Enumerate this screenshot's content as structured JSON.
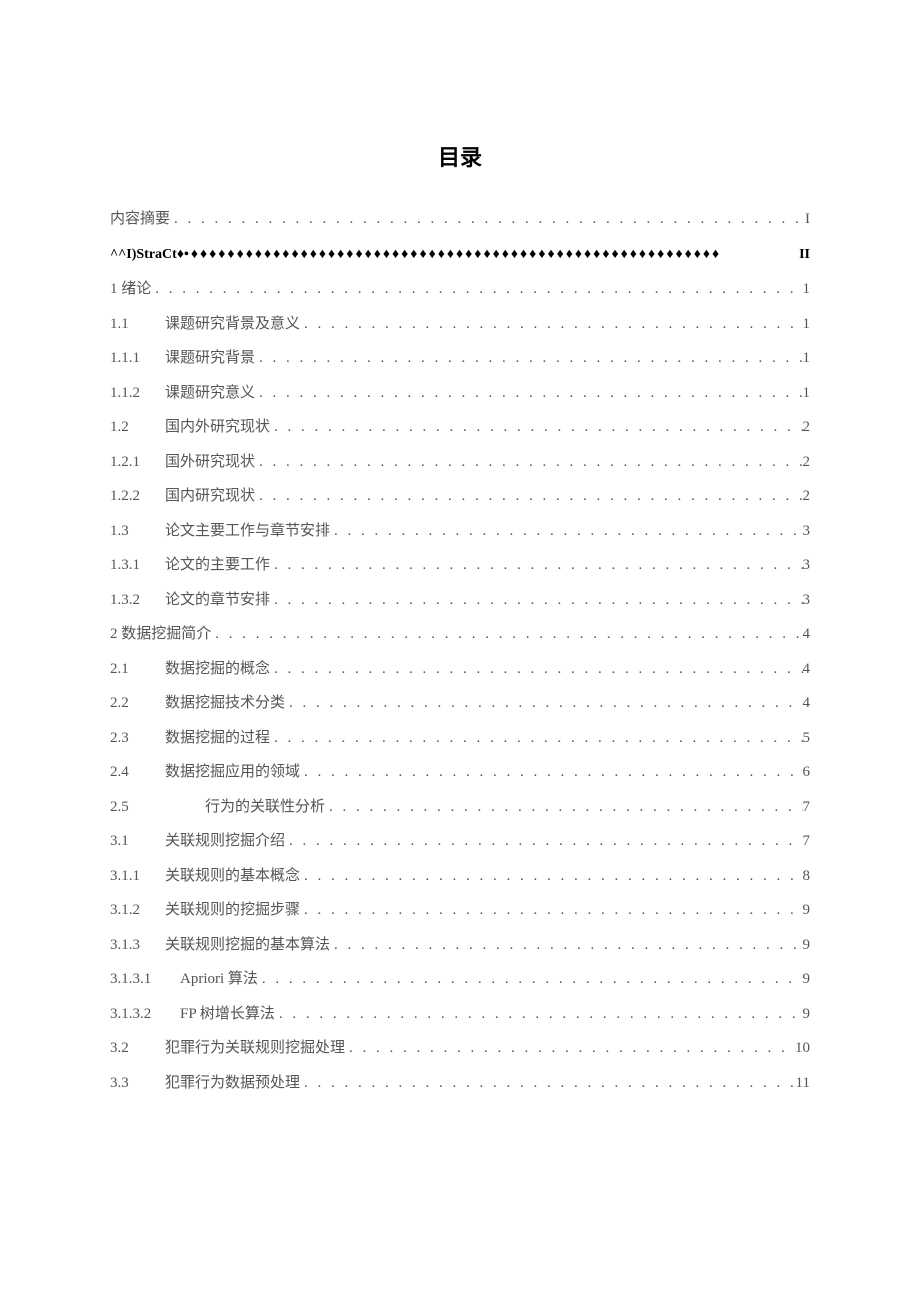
{
  "title": "目录",
  "preEntries": [
    {
      "label": "内容摘要",
      "leader": ". . . . . . . . . . . . . . . . . . . . . . . . . . . . . . . . . . . . . . . . . . . . . . . . . . . . . . . . . . . . . . . . . . . .",
      "page": "I"
    }
  ],
  "abstractLine": {
    "label": "^^I)StraCt♦•",
    "leader": "♦♦♦♦♦♦♦♦♦♦♦♦♦♦♦♦♦♦♦♦♦♦♦♦♦♦♦♦♦♦♦♦♦♦♦♦♦♦♦♦♦♦♦♦♦♦♦♦♦♦♦♦♦♦♦♦♦♦",
    "page": "II"
  },
  "entries": [
    {
      "num": "1 绪论",
      "label": "",
      "page": "1",
      "type": "chapter"
    },
    {
      "num": "1.1",
      "label": "课题研究背景及意义",
      "page": "1",
      "type": "section"
    },
    {
      "num": "1.1.1",
      "label": "课题研究背景",
      "page": "1",
      "type": "subsection"
    },
    {
      "num": "1.1.2",
      "label": "课题研究意义",
      "page": "1",
      "type": "subsection"
    },
    {
      "num": "1.2",
      "label": "国内外研究现状",
      "page": "2",
      "type": "section"
    },
    {
      "num": "1.2.1",
      "label": "国外研究现状",
      "page": "2",
      "type": "subsection"
    },
    {
      "num": "1.2.2",
      "label": "国内研究现状",
      "page": "2",
      "type": "subsection"
    },
    {
      "num": "1.3",
      "label": "论文主要工作与章节安排",
      "page": "3",
      "type": "section"
    },
    {
      "num": "1.3.1",
      "label": "论文的主要工作",
      "page": "3",
      "type": "subsection"
    },
    {
      "num": "1.3.2",
      "label": "论文的章节安排",
      "page": "3",
      "type": "subsection"
    },
    {
      "num": "2 数据挖掘简介",
      "label": "",
      "page": "4",
      "type": "chapter"
    },
    {
      "num": "2.1",
      "label": "数据挖掘的概念",
      "page": "4",
      "type": "section"
    },
    {
      "num": "2.2",
      "label": "数据挖掘技术分类",
      "page": "4",
      "type": "section"
    },
    {
      "num": "2.3",
      "label": "数据挖掘的过程",
      "page": "5",
      "type": "section"
    },
    {
      "num": "2.4",
      "label": "数据挖掘应用的领域",
      "page": "6",
      "type": "section"
    },
    {
      "num": "2.5",
      "label": "行为的关联性分析",
      "page": "7",
      "type": "section",
      "indent": true
    },
    {
      "num": "3.1",
      "label": "关联规则挖掘介绍",
      "page": "7",
      "type": "section"
    },
    {
      "num": "3.1.1",
      "label": "关联规则的基本概念",
      "page": "8",
      "type": "subsection"
    },
    {
      "num": "3.1.2",
      "label": "关联规则的挖掘步骤",
      "page": "9",
      "type": "subsection"
    },
    {
      "num": "3.1.3",
      "label": "关联规则挖掘的基本算法",
      "page": "9",
      "type": "subsection"
    },
    {
      "num": "3.1.3.1",
      "label": "Apriori 算法",
      "page": "9",
      "type": "subsubsection"
    },
    {
      "num": "3.1.3.2",
      "label": "FP 树增长算法",
      "page": "9",
      "type": "subsubsection"
    },
    {
      "num": "3.2",
      "label": "犯罪行为关联规则挖掘处理",
      "page": "10",
      "type": "section"
    },
    {
      "num": "3.3",
      "label": "犯罪行为数据预处理",
      "page": "11",
      "type": "section"
    }
  ],
  "leaderDots": ". . . . . . . . . . . . . . . . . . . . . . . . . . . . . . . . . . . . . . . . . . . . . . . . . . . . . . . . . . . . . . . . . . . . . . . . . . . . . . . . . . . . . . . . . . . . . . . . . . . ."
}
